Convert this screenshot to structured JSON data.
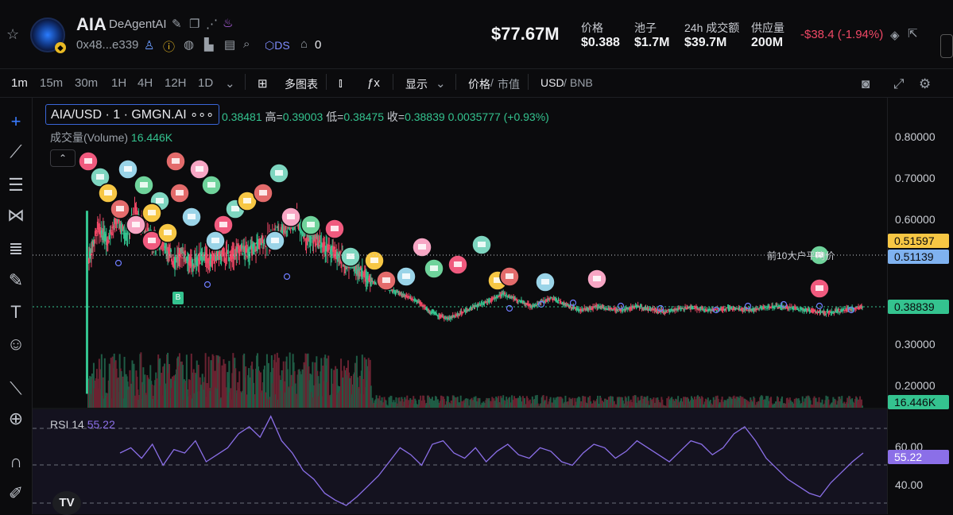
{
  "header": {
    "token_symbol": "AIA",
    "token_name": "DeAgentAI",
    "address": "0x48...e339",
    "ds_label": "DS",
    "holders_count": "0",
    "market_cap": "$77.67M",
    "stats": [
      {
        "label": "价格",
        "value": "$0.388"
      },
      {
        "label": "池子",
        "value": "$1.7M"
      },
      {
        "label": "24h 成交额",
        "value": "$39.7M"
      },
      {
        "label": "供应量",
        "value": "200M"
      }
    ],
    "change": "-$38.4 (-1.94%)"
  },
  "toolbar": {
    "intervals": [
      "1m",
      "15m",
      "30m",
      "1H",
      "4H",
      "12H",
      "1D"
    ],
    "active_interval": "1m",
    "multi_chart": "多图表",
    "display": "显示",
    "price_label": "价格",
    "mcap_label": "市值",
    "currency_usd": "USD",
    "currency_bnb": "BNB"
  },
  "legend": {
    "pair": "AIA/USD · 1 · GMGN.AI",
    "dots": "∘∘∘",
    "ohlc_open": "0.38481",
    "high_label": "高=",
    "high": "0.39003",
    "low_label": "低=",
    "low": "0.38475",
    "close_label": "收=",
    "close": "0.38839",
    "change": "0.0035777 (+0.93%)",
    "volume_label": "成交量(Volume)",
    "volume_value": "16.446K",
    "collapse": "⌃"
  },
  "price_axis": {
    "ticks": [
      "0.80000",
      "0.70000",
      "0.60000",
      "0.30000",
      "0.20000"
    ],
    "tag_top10": "0.51597",
    "tag_avg": "0.51139",
    "tag_current": "0.38839",
    "tag_volume": "16.446K"
  },
  "rsi": {
    "label": "RSI",
    "period": "14",
    "value": "55.22",
    "ticks": [
      "60.00",
      "40.00"
    ]
  },
  "annotation": "前10大户平均价",
  "bubble_b": "B",
  "tv_logo": "TV",
  "colors": {
    "up": "#34c38f",
    "down": "#f04866",
    "rsi": "#8b6fe8",
    "tag_yellow": "#f7c744",
    "tag_blue": "#7fb2f0"
  },
  "chart_data": {
    "type": "candlestick",
    "y_ticks": [
      0.8,
      0.7,
      0.6,
      0.3,
      0.2
    ],
    "ylim": [
      0.15,
      0.85
    ],
    "close_path": [
      0.5,
      0.58,
      0.55,
      0.6,
      0.56,
      0.62,
      0.58,
      0.54,
      0.55,
      0.5,
      0.52,
      0.49,
      0.51,
      0.5,
      0.52,
      0.51,
      0.53,
      0.52,
      0.54,
      0.55,
      0.57,
      0.58,
      0.6,
      0.56,
      0.55,
      0.53,
      0.52,
      0.5,
      0.49,
      0.47,
      0.45,
      0.44,
      0.43,
      0.42,
      0.41,
      0.4,
      0.38,
      0.37,
      0.36,
      0.37,
      0.38,
      0.39,
      0.4,
      0.41,
      0.42,
      0.41,
      0.4,
      0.39,
      0.4,
      0.41,
      0.4,
      0.39,
      0.38,
      0.385,
      0.39,
      0.385,
      0.38,
      0.385,
      0.39,
      0.385,
      0.38,
      0.378,
      0.382,
      0.385,
      0.388,
      0.384,
      0.38,
      0.383,
      0.386,
      0.384,
      0.382,
      0.385,
      0.388,
      0.39,
      0.387,
      0.384,
      0.381,
      0.378,
      0.375,
      0.378,
      0.382,
      0.386,
      0.388
    ],
    "rsi_ylim": [
      20,
      80
    ],
    "rsi_series": [
      55,
      58,
      52,
      60,
      48,
      57,
      55,
      62,
      50,
      54,
      58,
      66,
      70,
      64,
      76,
      62,
      55,
      45,
      40,
      32,
      28,
      25,
      30,
      36,
      42,
      50,
      58,
      54,
      48,
      60,
      62,
      55,
      52,
      58,
      50,
      56,
      60,
      54,
      52,
      58,
      56,
      50,
      48,
      55,
      60,
      58,
      52,
      56,
      62,
      58,
      54,
      50,
      56,
      62,
      60,
      54,
      58,
      66,
      70,
      62,
      52,
      46,
      40,
      36,
      32,
      30,
      38,
      44,
      50,
      55
    ]
  }
}
